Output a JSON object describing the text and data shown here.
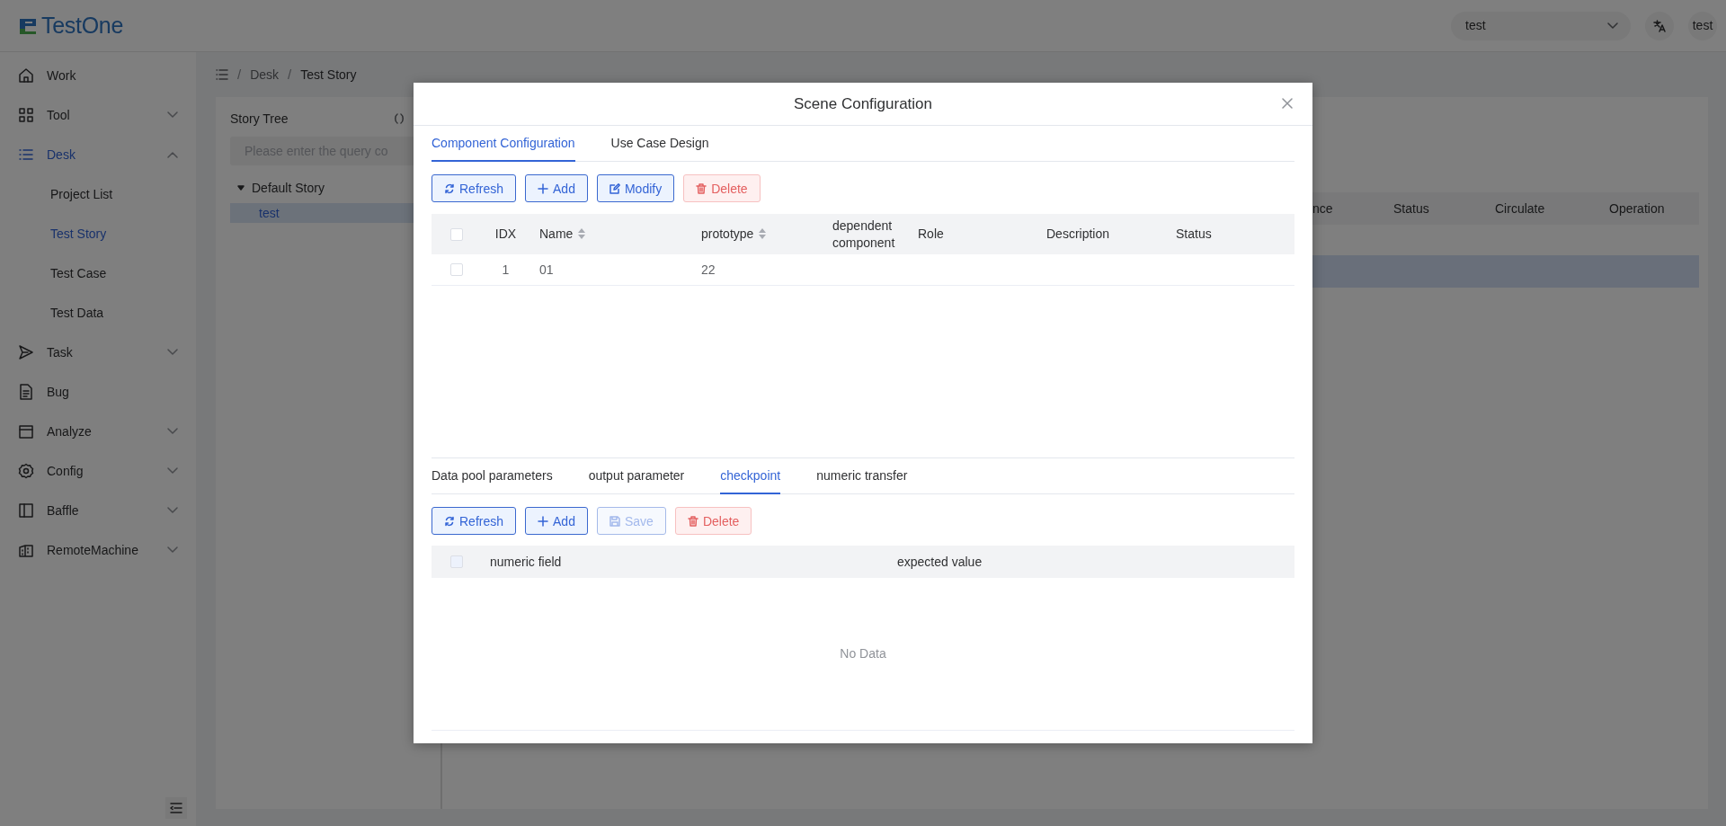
{
  "header": {
    "logo": "TestOne",
    "project_select": {
      "value": "test"
    },
    "user": "test"
  },
  "sidebar": {
    "items": [
      {
        "label": "Work",
        "selected": false
      },
      {
        "label": "Tool",
        "selected": false,
        "expanded": false
      },
      {
        "label": "Desk",
        "selected": true,
        "expanded": true,
        "children": [
          {
            "label": "Project List",
            "selected": false
          },
          {
            "label": "Test Story",
            "selected": true
          },
          {
            "label": "Test Case",
            "selected": false
          },
          {
            "label": "Test Data",
            "selected": false
          }
        ]
      },
      {
        "label": "Task",
        "selected": false,
        "expanded": false
      },
      {
        "label": "Bug",
        "selected": false
      },
      {
        "label": "Analyze",
        "selected": false,
        "expanded": false
      },
      {
        "label": "Config",
        "selected": false,
        "expanded": false
      },
      {
        "label": "Baffle",
        "selected": false,
        "expanded": false
      },
      {
        "label": "RemoteMachine",
        "selected": false,
        "expanded": false
      }
    ]
  },
  "breadcrumb": {
    "separator": "/",
    "items": [
      "Desk",
      "Test Story"
    ]
  },
  "story_tree": {
    "title": "Story Tree",
    "search": {
      "placeholder": "Please enter the query co"
    },
    "nodes": [
      {
        "label": "Default Story",
        "selected": false,
        "expanded": true,
        "children": [
          {
            "label": "test",
            "selected": true
          }
        ]
      }
    ]
  },
  "background_table": {
    "columns": [
      "nce",
      "Status",
      "Circulate",
      "Operation"
    ],
    "rows": [
      {
        "selected": true
      }
    ]
  },
  "modal": {
    "title": "Scene Configuration",
    "tabs": [
      {
        "label": "Component Configuration",
        "selected": true
      },
      {
        "label": "Use Case Design",
        "selected": false
      }
    ],
    "toolbar": [
      {
        "label": "Refresh",
        "kind": "refresh",
        "disabled": false
      },
      {
        "label": "Add",
        "kind": "add",
        "disabled": false
      },
      {
        "label": "Modify",
        "kind": "modify",
        "disabled": false
      },
      {
        "label": "Delete",
        "kind": "delete",
        "disabled": false
      }
    ],
    "table": {
      "select_all": {
        "checked": false,
        "disabled": false
      },
      "columns": [
        {
          "label": "IDX",
          "sortable": false
        },
        {
          "label": "Name",
          "sortable": true
        },
        {
          "label": "prototype",
          "sortable": true
        },
        {
          "label": "dependent component",
          "sortable": false
        },
        {
          "label": "Role",
          "sortable": false
        },
        {
          "label": "Description",
          "sortable": false
        },
        {
          "label": "Status",
          "sortable": false
        }
      ],
      "rows": [
        {
          "checked": false,
          "idx": "1",
          "name": "01",
          "prototype": "22"
        }
      ]
    },
    "lower_tabs": [
      {
        "label": "Data pool parameters",
        "selected": false
      },
      {
        "label": "output parameter",
        "selected": false
      },
      {
        "label": "checkpoint",
        "selected": true
      },
      {
        "label": "numeric transfer",
        "selected": false
      }
    ],
    "lower_toolbar": [
      {
        "label": "Refresh",
        "kind": "refresh",
        "disabled": false
      },
      {
        "label": "Add",
        "kind": "add",
        "disabled": false
      },
      {
        "label": "Save",
        "kind": "save",
        "disabled": true
      },
      {
        "label": "Delete",
        "kind": "delete",
        "disabled": false
      }
    ],
    "lower_table": {
      "select_all": {
        "checked": false,
        "disabled": true
      },
      "columns": [
        "numeric field",
        "expected value"
      ],
      "empty_text": "No Data"
    }
  }
}
